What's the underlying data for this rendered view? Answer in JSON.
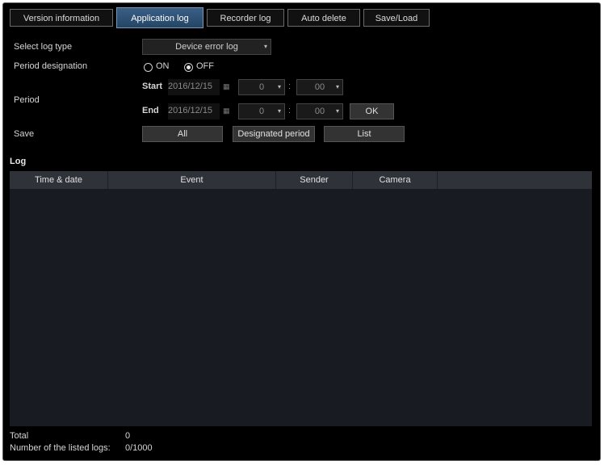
{
  "tabs": [
    {
      "label": "Version information",
      "active": false
    },
    {
      "label": "Application log",
      "active": true
    },
    {
      "label": "Recorder log",
      "active": false
    },
    {
      "label": "Auto delete",
      "active": false
    },
    {
      "label": "Save/Load",
      "active": false
    }
  ],
  "form": {
    "select_log_type_label": "Select log type",
    "log_type_value": "Device error log",
    "period_designation_label": "Period designation",
    "radio_on": "ON",
    "radio_off": "OFF",
    "period_label": "Period",
    "start_label": "Start",
    "start_date": "2016/12/15",
    "start_hour": "0",
    "start_min": "00",
    "end_label": "End",
    "end_date": "2016/12/15",
    "end_hour": "0",
    "end_min": "00",
    "colon": ":",
    "ok_button": "OK",
    "save_label": "Save",
    "save_all": "All",
    "save_designated": "Designated period",
    "save_list": "List"
  },
  "log": {
    "title": "Log",
    "columns": [
      "Time & date",
      "Event",
      "Sender",
      "Camera"
    ],
    "total_label": "Total",
    "total_value": "0",
    "listed_label": "Number of the listed logs:",
    "listed_value": "0/1000"
  }
}
